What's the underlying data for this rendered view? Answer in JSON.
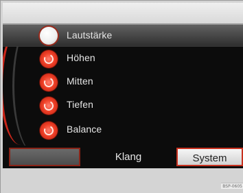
{
  "menu": {
    "items": [
      {
        "label": "Lautstärke",
        "selected": true,
        "knob_color": "#ffffff"
      },
      {
        "label": "Höhen",
        "selected": false,
        "knob_color": "#e8432a"
      },
      {
        "label": "Mitten",
        "selected": false,
        "knob_color": "#e8432a"
      },
      {
        "label": "Tiefen",
        "selected": false,
        "knob_color": "#e8432a"
      },
      {
        "label": "Balance",
        "selected": false,
        "knob_color": "#e8432a"
      }
    ]
  },
  "tabs": {
    "empty_label": "",
    "klang_label": "Klang",
    "system_label": "System"
  },
  "image_code": "BSP-0605",
  "colors": {
    "accent_red": "#c8311f",
    "panel_background": "#0c0c0c",
    "frame_gray": "#d4d4d4"
  }
}
